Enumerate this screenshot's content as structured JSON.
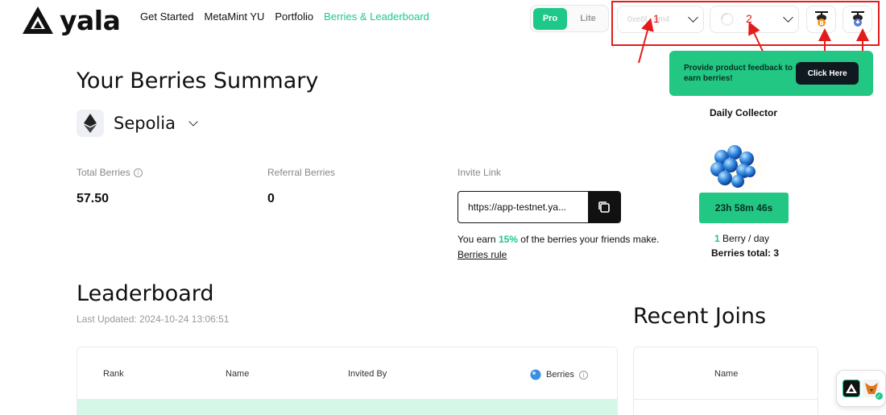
{
  "header": {
    "brand": "yala",
    "nav": [
      {
        "label": "Get Started"
      },
      {
        "label": "MetaMint YU"
      },
      {
        "label": "Portfolio"
      },
      {
        "label": "Berries & Leaderboard",
        "active": true
      }
    ],
    "mode_toggle": {
      "pro": "Pro",
      "lite": "Lite",
      "selected": "Pro"
    },
    "selector1_text": "0xe6f...9m4",
    "selector2_text": "",
    "annotation_labels": [
      "1",
      "2"
    ]
  },
  "feedback_banner": {
    "text": "Provide product feedback to earn berries!",
    "button": "Click Here"
  },
  "summary": {
    "title": "Your Berries Summary",
    "network": "Sepolia",
    "total_label": "Total Berries",
    "total_value": "57.50",
    "referral_label": "Referral Berries",
    "referral_value": "0",
    "invite_label": "Invite Link",
    "invite_url": "https://app-testnet.ya...",
    "earn_prefix": "You earn ",
    "earn_pct": "15%",
    "earn_suffix": " of the berries your friends make.",
    "rule_link": "Berries rule"
  },
  "daily": {
    "title": "Daily Collector",
    "timer": "23h 58m 46s",
    "per_day_num": "1",
    "per_day_suffix": " Berry / day",
    "total": "Berries total: 3"
  },
  "leaderboard": {
    "title": "Leaderboard",
    "last_updated": "Last Updated: 2024-10-24 13:06:51",
    "columns": [
      "Rank",
      "Name",
      "Invited By",
      "Berries"
    ]
  },
  "recent_joins": {
    "title": "Recent Joins",
    "columns": [
      "Name"
    ]
  },
  "colors": {
    "accent": "#1dc888",
    "annotation": "#e41b1b",
    "dark": "#101820"
  }
}
